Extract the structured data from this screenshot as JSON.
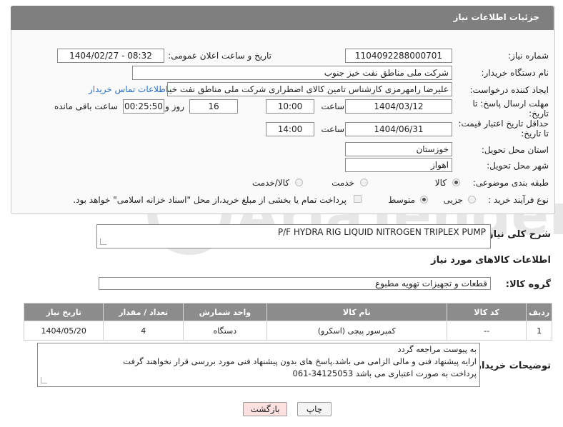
{
  "header": {
    "title": "جزئیات اطلاعات نیاز"
  },
  "form": {
    "need_number_label": "شماره نیاز:",
    "need_number": "1104092288000701",
    "announce_label": "تاریخ و ساعت اعلان عمومی:",
    "announce_value": "1404/02/27 - 08:32",
    "buyer_org_label": "نام دستگاه خریدار:",
    "buyer_org": "شرکت ملی مناطق نفت خیز جنوب",
    "creator_label": "ایجاد کننده درخواست:",
    "creator": "علیرضا رامهرمزی کارشناس تامین کالای اضطراری شرکت ملی مناطق نفت خیز جنوب",
    "contact_link": "اطلاعات تماس خریدار",
    "deadline_label_1": "مهلت ارسال پاسخ: تا",
    "deadline_label_2": "تاریخ:",
    "deadline_date": "1404/03/12",
    "time_label": "ساعت",
    "deadline_time": "10:00",
    "days_value": "16",
    "days_label": "روز و",
    "remaining_value": "00:25:50",
    "remaining_label": "ساعت باقی مانده",
    "min_price_label_1": "حداقل تاریخ اعتبار قیمت:",
    "min_price_label_2": "تا تاریخ:",
    "price_date": "1404/06/31",
    "price_time_label": "ساعت",
    "price_time": "14:00",
    "province_label": "استان محل تحویل:",
    "province": "خوزستان",
    "city_label": "شهر محل تحویل:",
    "city": "اهواز",
    "category_label": "طبقه بندی موضوعی:",
    "category_options": [
      "کالا",
      "خدمت",
      "کالا/خدمت"
    ],
    "purchase_type_label": "نوع فرآیند خرید :",
    "purchase_options": [
      "جزیی",
      "متوسط"
    ],
    "purchase_note": "پرداخت تمام یا بخشی از مبلغ خرید،از محل \"اسناد خزانه اسلامی\" خواهد بود."
  },
  "summary": {
    "label": "شرح کلی نیاز:",
    "value": "P/F HYDRA RIG LIQUID NITROGEN TRIPLEX PUMP"
  },
  "goods": {
    "section_title": "اطلاعات کالاهای مورد نیاز",
    "group_label": "گروه کالا:",
    "group_value": "قطعات و تجهیزات تهویه مطبوع",
    "columns": [
      "ردیف",
      "کد کالا",
      "نام کالا",
      "واحد شمارش",
      "تعداد / مقدار",
      "تاریخ نیاز"
    ],
    "rows": [
      {
        "row": "1",
        "code": "--",
        "name": "کمپرسور پیچی (اسکرو)",
        "unit": "دستگاه",
        "qty": "4",
        "date": "1404/05/20"
      }
    ]
  },
  "buyer_notes": {
    "label": "توضیحات خریدار:",
    "lines": [
      "به پیوست مراجعه گردد",
      "ارایه پیشنهاد فنی و مالی الزامی می باشد.پاسخ های بدون پیشنهاد فنی مورد بررسی قرار نخواهند گرفت",
      "پرداخت به صورت اعتباری می باشد 34125053-061"
    ]
  },
  "actions": {
    "print": "چاپ",
    "back": "بازگشت"
  },
  "watermark_text": "AriaTender.neT",
  "colors": {
    "header_bg": "#7f7f7f",
    "link": "#2a6ec6",
    "back_btn_bg": "#fde0e0"
  }
}
